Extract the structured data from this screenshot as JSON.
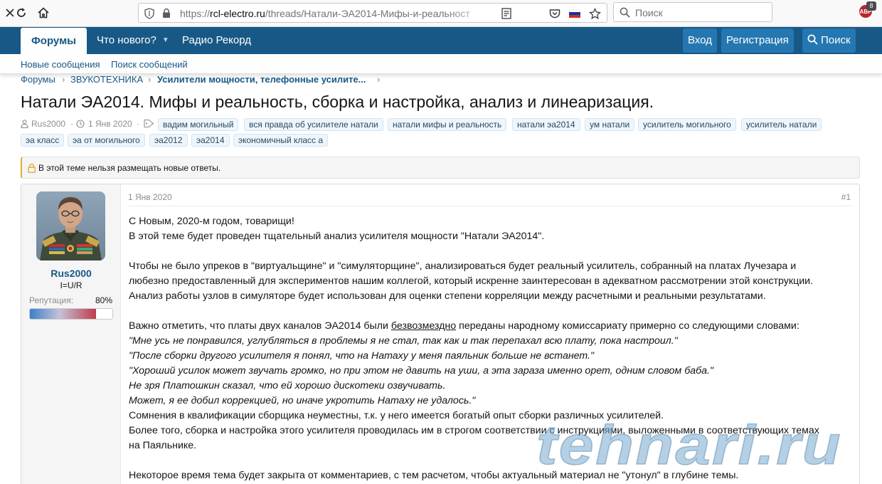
{
  "browser": {
    "url_scheme": "https://",
    "url_host": "rcl-electro.ru",
    "url_path": "/threads/Натали-ЭА2014-Мифы-и-реальност",
    "search_placeholder": "Поиск",
    "extension_badge": "ABP",
    "extension_count": "8"
  },
  "nav": {
    "tabs": [
      {
        "label": "Форумы"
      },
      {
        "label": "Что нового?"
      },
      {
        "label": "Радио Рекорд"
      }
    ],
    "login": "Вход",
    "register": "Регистрация",
    "search": "Поиск"
  },
  "subnav": {
    "new_posts": "Новые сообщения",
    "search_posts": "Поиск сообщений"
  },
  "breadcrumb": {
    "items": [
      "Форумы",
      "ЗВУКОТЕХНИКА",
      "Усилители мощности, телефонные усилите..."
    ]
  },
  "thread": {
    "title": "Натали ЭА2014. Мифы и реальность, сборка и настройка, анализ и линеаризация.",
    "author": "Rus2000",
    "date": "1 Янв 2020",
    "tags": [
      "вадим могильный",
      "вся правда об усилителе натали",
      "натали мифы и реальность",
      "натали эа2014",
      "ум натали",
      "усилитель могильного",
      "усилитель натали",
      "эа класс",
      "эа от могильного",
      "эа2012",
      "эа2014",
      "экономичный класс а"
    ],
    "locked_notice": "В этой теме нельзя размещать новые ответы."
  },
  "post": {
    "username": "Rus2000",
    "user_title": "I=U/R",
    "reputation_label": "Репутация:",
    "reputation_value": "80%",
    "reputation_fraction": 0.8,
    "date": "1 Янв 2020",
    "number": "#1",
    "lines": [
      "С Новым, 2020-м годом, товарищи!",
      "В этой теме будет проведен тщательный анализ усилителя мощности \"Натали ЭА2014\".",
      "Чтобы не было упреков в \"виртуальщине\" и \"симуляторщине\", анализироваться будет реальный усилитель, собранный на платах Лучезара и",
      "любезно предоставленный для экспериментов нашим коллегой, который искренне заинтересован в адекватном рассмотрении этой конструкции.",
      "Анализ работы узлов в симуляторе будет использован для оценки степени корреляции между расчетными и реальными результатами.",
      "Важно отметить, что платы двух каналов ЭА2014 были",
      "безвозмездно",
      "переданы народному комиссариату примерно со следующими словами:",
      "\"Мне усь не понравился, углубляться в проблемы я не стал, так как и так перепахал всю плату, пока настроил.\"",
      "\"После сборки другого усилителя я понял, что на Натаху у меня паяльник больше не встанет.\"",
      "\"Хороший усилок может звучать громко, но при этом не давить на уши, а эта зараза именно орет, одним словом баба.\"",
      "Не зря Платошкин сказал, что ей хорошо дискотеки озвучивать.",
      "Может, я ее добил коррекцией, но иначе укротить Натаху не удалось.\"",
      "Сомнения в квалификации сборщика неуместны, т.к. у него имеется богатый опыт сборки различных усилителей.",
      "Более того, сборка и настройка этого усилителя проводилась им в строгом соответствии с инструкциями, выложенными в соответствующих темах",
      "на Паяльнике.",
      "Некоторое время тема будет закрыта от комментариев, с тем расчетом, чтобы актуальный материал не \"утонул\" в глубине темы."
    ]
  },
  "watermark": "tehnari.ru",
  "colors": {
    "nav_bg": "#185886",
    "nav_button": "#2577b1",
    "link": "#185886",
    "lock_accent": "#e5ac33"
  }
}
